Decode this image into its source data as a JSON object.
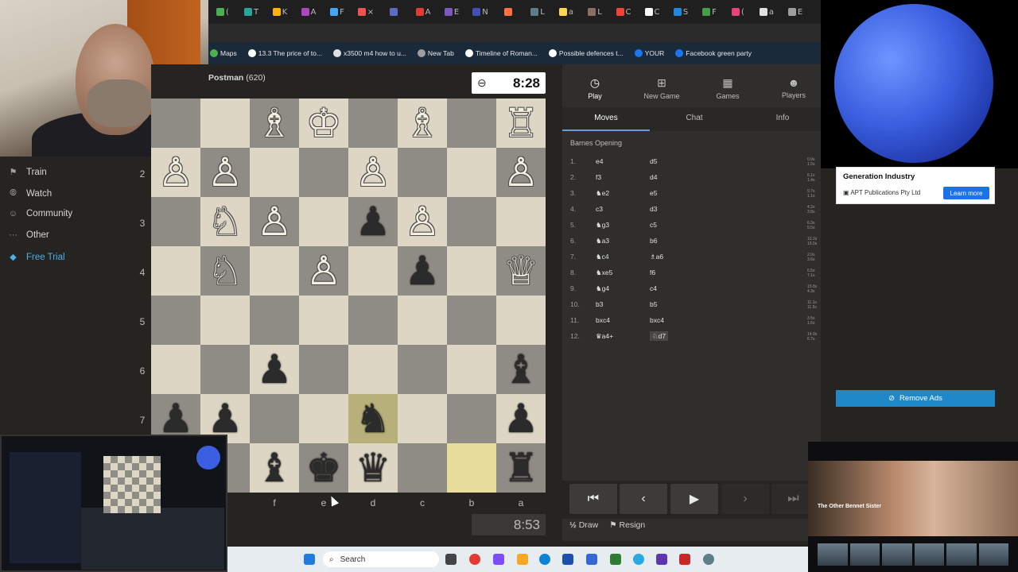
{
  "browser": {
    "tab_labels": [
      "(",
      "T",
      "K",
      "A",
      "F",
      "×",
      "",
      "A",
      "E",
      "N",
      "",
      "L",
      "a",
      "L",
      "C",
      "C",
      "S",
      "F",
      "(",
      "a",
      "E"
    ],
    "bookmarks": [
      {
        "label": "Maps",
        "icon": "map-icon",
        "color": "#4caf50"
      },
      {
        "label": "13.3 The price of to...",
        "icon": "doc-icon",
        "color": "#ffffff"
      },
      {
        "label": "x3500 m4 how to u...",
        "icon": "google-icon",
        "color": "#e0e0e0"
      },
      {
        "label": "New Tab",
        "icon": "tab-icon",
        "color": "#9e9e9e"
      },
      {
        "label": "Timeline of Roman...",
        "icon": "wikipedia-icon",
        "color": "#ffffff"
      },
      {
        "label": "Possible defences t...",
        "icon": "cl-icon",
        "color": "#ffffff"
      },
      {
        "label": "YOUR",
        "icon": "facebook-icon",
        "color": "#1877f2"
      },
      {
        "label": "Facebook green party",
        "icon": "facebook-icon",
        "color": "#1877f2"
      }
    ]
  },
  "sidebar": {
    "items": [
      {
        "label": "Train",
        "icon": "train-icon"
      },
      {
        "label": "Watch",
        "icon": "binoculars-icon"
      },
      {
        "label": "Community",
        "icon": "community-icon"
      },
      {
        "label": "Other",
        "icon": "more-icon"
      },
      {
        "label": "Free Trial",
        "icon": "diamond-icon",
        "color": "#49b0e8"
      }
    ]
  },
  "game": {
    "opponent": "Postman",
    "opponent_rating": "(620)",
    "clock_top": "8:28",
    "clock_bottom": "8:53",
    "rank_labels": [
      "2",
      "3",
      "4",
      "5",
      "6",
      "7"
    ],
    "file_labels": [
      "f",
      "e",
      "d",
      "c",
      "b",
      "a"
    ],
    "board": [
      [
        "",
        "",
        "♗",
        "♔",
        "",
        "♗",
        "",
        "♖"
      ],
      [
        "♙",
        "♙",
        "",
        "",
        "♙",
        "",
        "",
        "♙"
      ],
      [
        "",
        "♘",
        "♙",
        "",
        "♟",
        "♙",
        "",
        ""
      ],
      [
        "",
        "♘",
        "",
        "♙",
        "",
        "♟",
        "",
        "♕"
      ],
      [
        "",
        "",
        "",
        "",
        "",
        "",
        "",
        ""
      ],
      [
        "",
        "",
        "♟",
        "",
        "",
        "",
        "",
        "♝"
      ],
      [
        "♟",
        "♟",
        "",
        "",
        "♞",
        "",
        "",
        "♟"
      ],
      [
        "♜",
        "",
        "♝",
        "♚",
        "♛",
        "",
        "",
        "♜"
      ]
    ],
    "highlight": [
      [
        6,
        4
      ],
      [
        7,
        6
      ]
    ]
  },
  "panel": {
    "tabs": [
      {
        "label": "Play",
        "icon": "stopwatch-icon"
      },
      {
        "label": "New Game",
        "icon": "plus-icon"
      },
      {
        "label": "Games",
        "icon": "board-icon"
      },
      {
        "label": "Players",
        "icon": "players-icon"
      }
    ],
    "subtabs": [
      "Moves",
      "Chat",
      "Info"
    ],
    "opening": "Barnes Opening",
    "moves": [
      {
        "n": "1.",
        "w": "e4",
        "b": "d5",
        "t": [
          "0.9s",
          "1.0s"
        ]
      },
      {
        "n": "2.",
        "w": "f3",
        "b": "d4",
        "t": [
          "6.1s",
          "1.4s"
        ]
      },
      {
        "n": "3.",
        "w": "♞e2",
        "b": "e5",
        "t": [
          "9.7s",
          "1.1s"
        ]
      },
      {
        "n": "4.",
        "w": "c3",
        "b": "d3",
        "t": [
          "4.2s",
          "3.8s"
        ]
      },
      {
        "n": "5.",
        "w": "♞g3",
        "b": "c5",
        "t": [
          "6.3s",
          "5.5s"
        ]
      },
      {
        "n": "6.",
        "w": "♞a3",
        "b": "b6",
        "t": [
          "10.2s",
          "19.0s"
        ]
      },
      {
        "n": "7.",
        "w": "♞c4",
        "b": "♗a6",
        "t": [
          "2.0s",
          "3.6s"
        ]
      },
      {
        "n": "8.",
        "w": "♞xe5",
        "b": "f6",
        "t": [
          "6.5s",
          "7.1s"
        ]
      },
      {
        "n": "9.",
        "w": "♞g4",
        "b": "c4",
        "t": [
          "15.8s",
          "4.3s"
        ]
      },
      {
        "n": "10.",
        "w": "b3",
        "b": "b5",
        "t": [
          "11.1s",
          "11.5s"
        ]
      },
      {
        "n": "11.",
        "w": "bxc4",
        "b": "bxc4",
        "t": [
          "3.5s",
          "1.6s"
        ]
      },
      {
        "n": "12.",
        "w": "♛a4+",
        "b": "♘d7",
        "t": [
          "14.9s",
          "6.7s"
        ]
      }
    ],
    "draw_label": "Draw",
    "draw_icon_text": "½",
    "resign_label": "Resign"
  },
  "ad": {
    "title": "Generation Industry",
    "sponsor": "APT Publications Pty Ltd",
    "cta": "Learn more",
    "remove_ads": "Remove Ads"
  },
  "streaming_thumb": {
    "title": "The Other Bennet Sister"
  },
  "taskbar": {
    "search_placeholder": "Search"
  }
}
